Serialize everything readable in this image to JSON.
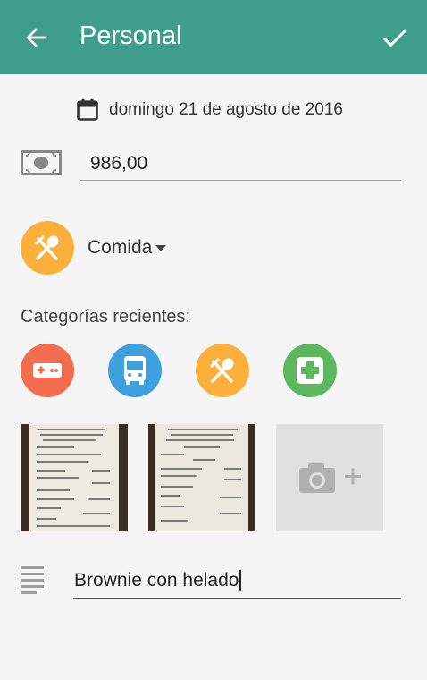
{
  "header": {
    "title": "Personal"
  },
  "date": {
    "text": "domingo 21 de agosto de 2016"
  },
  "amount": {
    "value": "986,00"
  },
  "category": {
    "selected": "Comida"
  },
  "recent": {
    "label": "Categorías recientes:",
    "items": [
      "gamepad-icon",
      "bus-icon",
      "utensils-icon",
      "medical-icon"
    ]
  },
  "notes": {
    "value": "Brownie con helado"
  },
  "colors": {
    "header": "#3f9e8b",
    "food": "#fbb03b",
    "games": "#f26c4f",
    "transport": "#3fa0de",
    "health": "#5cb85c"
  }
}
